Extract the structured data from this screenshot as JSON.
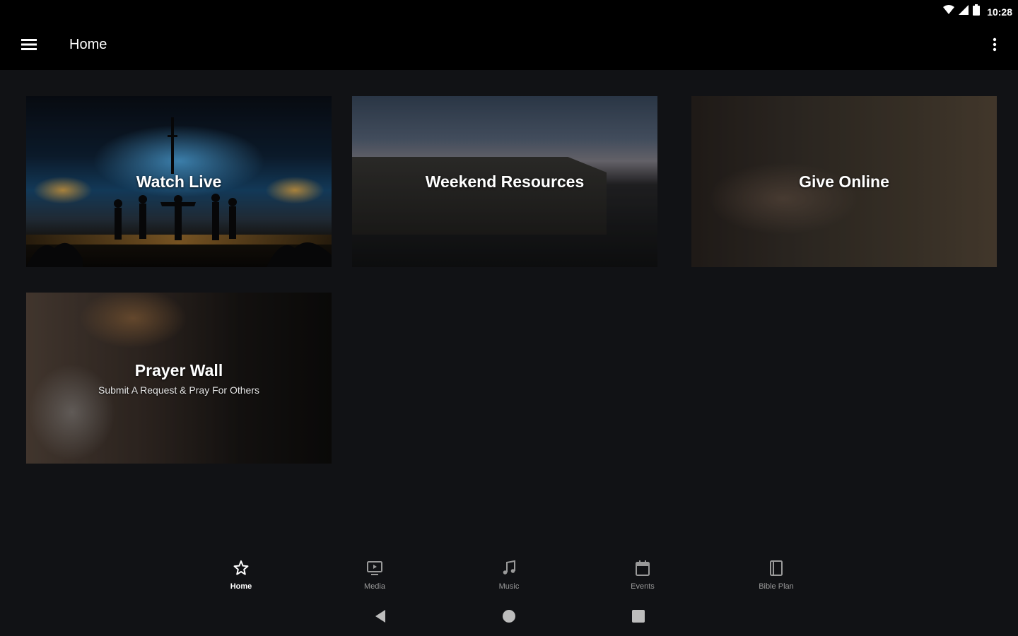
{
  "status_bar": {
    "time": "10:28",
    "icons": [
      "wifi-icon",
      "signal-icon",
      "battery-icon"
    ]
  },
  "app_bar": {
    "title": "Home",
    "menu_icon": "menu-icon",
    "more_icon": "more-vert-icon"
  },
  "tiles": [
    {
      "title": "Watch Live"
    },
    {
      "title": "Weekend Resources"
    },
    {
      "title": "Give Online"
    },
    {
      "title": "Prayer Wall",
      "subtitle": "Submit A Request & Pray For Others"
    }
  ],
  "bottom_nav": {
    "items": [
      {
        "label": "Home",
        "icon": "star-icon",
        "active": true
      },
      {
        "label": "Media",
        "icon": "tv-icon",
        "active": false
      },
      {
        "label": "Music",
        "icon": "music-note-icon",
        "active": false
      },
      {
        "label": "Events",
        "icon": "calendar-icon",
        "active": false
      },
      {
        "label": "Bible Plan",
        "icon": "book-icon",
        "active": false
      }
    ]
  },
  "system_nav": {
    "buttons": [
      "back-icon",
      "home-circle-icon",
      "recents-icon"
    ]
  },
  "colors": {
    "background": "#111215",
    "app_bar": "#000000",
    "active_nav": "#ffffff",
    "inactive_nav": "#9a9a9a"
  }
}
